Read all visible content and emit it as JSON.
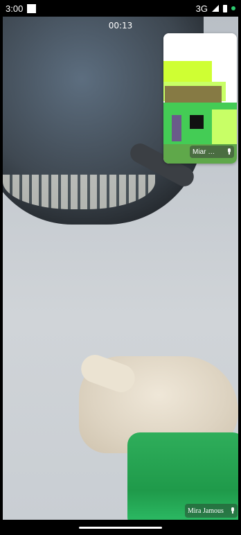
{
  "status_bar": {
    "time": "3:00",
    "network": "3G"
  },
  "call": {
    "duration": "00:13",
    "remote_participant_name": "Mira Jamous",
    "self_preview_name": "Miar …"
  }
}
